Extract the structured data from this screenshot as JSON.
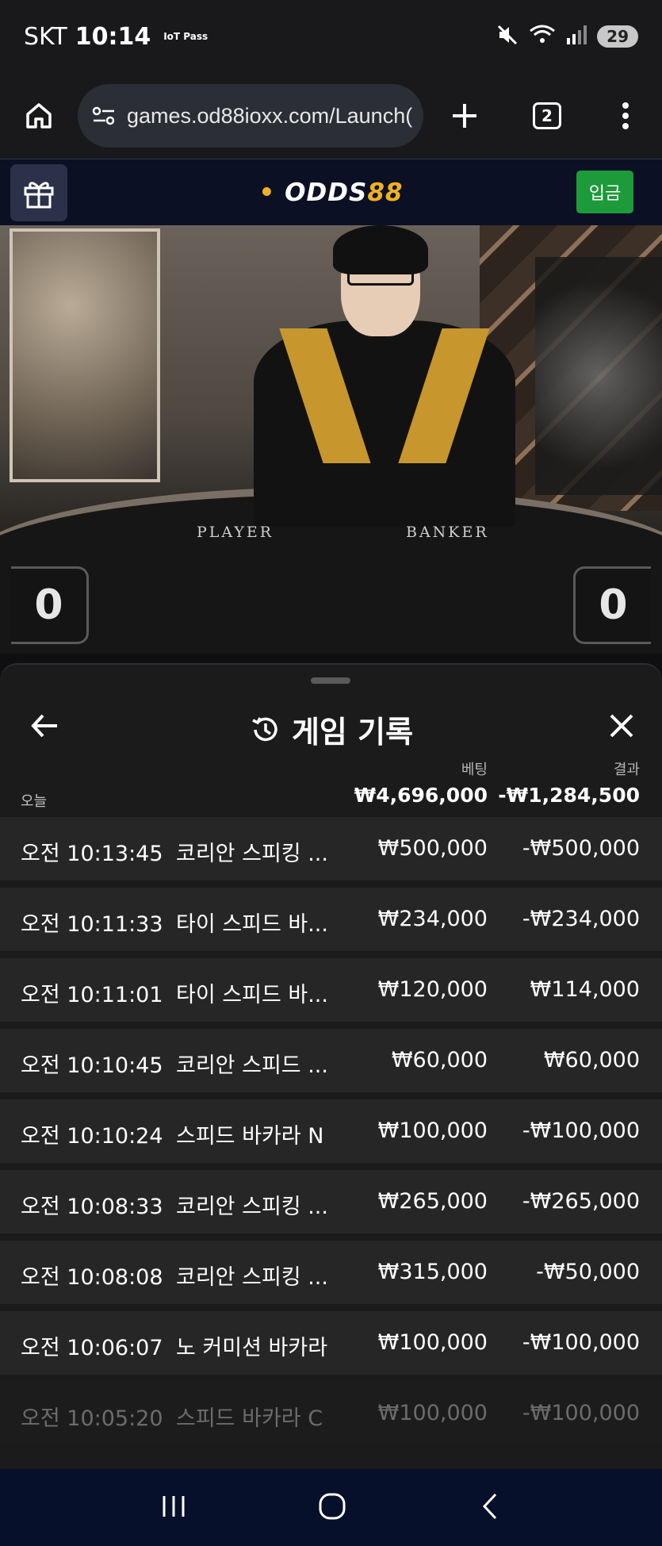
{
  "status_bar": {
    "carrier": "SKT",
    "time": "10:14",
    "iot_badge": "IoT Pass",
    "battery": "29"
  },
  "browser": {
    "url": "games.od88ioxx.com/Launch(",
    "tab_count": "2"
  },
  "site": {
    "logo_part1": "ODDS",
    "logo_part2": "88",
    "deposit_label": "입금"
  },
  "video": {
    "player_label": "PLAYER",
    "banker_label": "BANKER",
    "player_score": "0",
    "banker_score": "0"
  },
  "history": {
    "title": "게임 기록",
    "col_bet": "베팅",
    "col_result": "결과",
    "today_label": "오늘",
    "today_bet": "₩4,696,000",
    "today_result": "-₩1,284,500",
    "rows": [
      {
        "time": "오전 10:13:45",
        "game": "코리안 스피킹 ...",
        "bet": "₩500,000",
        "result": "-₩500,000"
      },
      {
        "time": "오전 10:11:33",
        "game": "타이 스피드 바...",
        "bet": "₩234,000",
        "result": "-₩234,000"
      },
      {
        "time": "오전 10:11:01",
        "game": "타이 스피드 바...",
        "bet": "₩120,000",
        "result": "₩114,000"
      },
      {
        "time": "오전 10:10:45",
        "game": "코리안 스피드 ...",
        "bet": "₩60,000",
        "result": "₩60,000"
      },
      {
        "time": "오전 10:10:24",
        "game": "스피드 바카라 N",
        "bet": "₩100,000",
        "result": "-₩100,000"
      },
      {
        "time": "오전 10:08:33",
        "game": "코리안 스피킹 ...",
        "bet": "₩265,000",
        "result": "-₩265,000"
      },
      {
        "time": "오전 10:08:08",
        "game": "코리안 스피킹 ...",
        "bet": "₩315,000",
        "result": "-₩50,000"
      },
      {
        "time": "오전 10:06:07",
        "game": "노 커미션 바카라",
        "bet": "₩100,000",
        "result": "-₩100,000"
      },
      {
        "time": "오전 10:05:20",
        "game": "스피드 바카라 C",
        "bet": "₩100,000",
        "result": "-₩100,000"
      }
    ]
  },
  "colors": {
    "accent_gold": "#f0b020",
    "deposit_green": "#1d9a3a",
    "header_navy": "#0b1024"
  },
  "icons": [
    "home-icon",
    "site-info-icon",
    "plus-icon",
    "tabs-icon",
    "more-icon",
    "gift-icon",
    "back-arrow-icon",
    "history-icon",
    "close-icon",
    "recent-apps-icon",
    "home-nav-icon",
    "back-nav-icon"
  ]
}
